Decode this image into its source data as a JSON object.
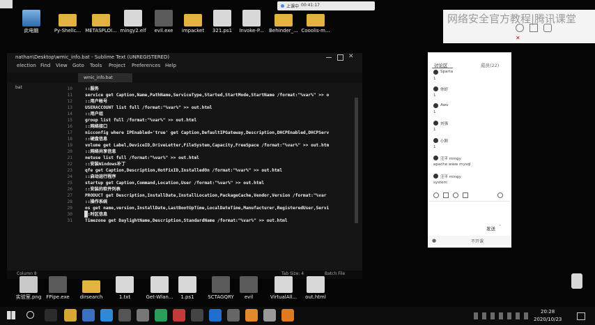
{
  "desktop_top_icons": [
    "此电脑",
    "Py-Shellc...",
    "METASPLOI...",
    "mingy2.elf",
    "evil.exe",
    "impacket",
    "321.ps1",
    "Invoke-P...",
    "Behinder_...",
    "Cooolis-m..."
  ],
  "record_bar": {
    "label": "上课中",
    "time": "00:41:17"
  },
  "watermark": "网络安全官方教程|腾讯课堂",
  "editor": {
    "title": "nathan\\Desktop\\wmic_info.bat - Sublime Text (UNREGISTERED)",
    "menu": [
      "election",
      "Find",
      "View",
      "Goto",
      "Tools",
      "Project",
      "Preferences",
      "Help"
    ],
    "sidebar_label": "bat",
    "tab": "wmic_info.bat",
    "lines": [
      {
        "n": "10",
        "t": "::服务"
      },
      {
        "n": "11",
        "t": "service get Caption,Name,PathName,ServiceType,Started,StartMode,StartName /format:\"%var%\" >> o"
      },
      {
        "n": "12",
        "t": "::用户帐号"
      },
      {
        "n": "13",
        "t": "USERACCOUNT list full /format:\"%var%\" >> out.html"
      },
      {
        "n": "14",
        "t": "::用户组"
      },
      {
        "n": "15",
        "t": "group list full /format:\"%var%\" >> out.html"
      },
      {
        "n": "16",
        "t": "::网络接口"
      },
      {
        "n": "17",
        "t": "nicconfig where IPEnabled='true' get Caption,DefaultIPGateway,Description,DHCPEnabled,DHCPServ"
      },
      {
        "n": "18",
        "t": "::硬盘信息"
      },
      {
        "n": "19",
        "t": "volume get Label,DeviceID,DriveLetter,FileSystem,Capacity,FreeSpace /format:\"%var%\" >> out.htm"
      },
      {
        "n": "20",
        "t": "::网络共享信息"
      },
      {
        "n": "21",
        "t": "netuse list full /format:\"%var%\" >> out.html"
      },
      {
        "n": "22",
        "t": "::安装Windows补丁"
      },
      {
        "n": "23",
        "t": "qfe get Caption,Description,HotFixID,InstalledOn /format:\"%var%\" >> out.html"
      },
      {
        "n": "24",
        "t": "::启动运行程序"
      },
      {
        "n": "25",
        "t": "startup get Caption,Command,Location,User /format:\"%var%\" >> out.html"
      },
      {
        "n": "26",
        "t": "::安装的软件列表"
      },
      {
        "n": "27",
        "t": "PRODUCT get Description,InstallDate,InstallLocation,PackageCache,Vendor,Version /format:\"%var"
      },
      {
        "n": "28",
        "t": "::操作系统"
      },
      {
        "n": "29",
        "t": "os get name,version,InstallDate,LastBootUpTime,LocalDateTime,Manufacturer,RegisteredUser,Servi"
      },
      {
        "n": "30",
        "t": "::时区信息"
      },
      {
        "n": "31",
        "t": "Timezone get DaylightName,Description,StandardName /format:\"%var%\" >> out.html"
      }
    ],
    "status_left": "Column 8",
    "status_tab": "Tab Size: 4",
    "status_syntax": "Batch File"
  },
  "chat_panel": {
    "tab_discussion": "讨论区",
    "tab_members": "成员(22)",
    "entries": [
      {
        "user": "Sparta",
        "msg": "1"
      },
      {
        "user": "你好",
        "msg": "1"
      },
      {
        "user": "Awu",
        "msg": "1"
      },
      {
        "user": "刘强",
        "msg": "1"
      },
      {
        "user": "小刚",
        "msg": "1"
      },
      {
        "user": "汪平 mingy",
        "msg": "apache www mysql"
      },
      {
        "user": "汪平 mingy",
        "msg": "system"
      }
    ],
    "send_label": "发送",
    "bottom_label": "不开课"
  },
  "desktop_bottom_icons": [
    "实验室.png",
    "FPipe.exe",
    "dirsearch",
    "1.txt",
    "Get-Wlan...",
    "1.ps1",
    "SCTAGQRY",
    "evil",
    "VirtualAll...",
    "out.html"
  ],
  "taskbar": {
    "time": "20:28",
    "date": "2020/10/23"
  }
}
